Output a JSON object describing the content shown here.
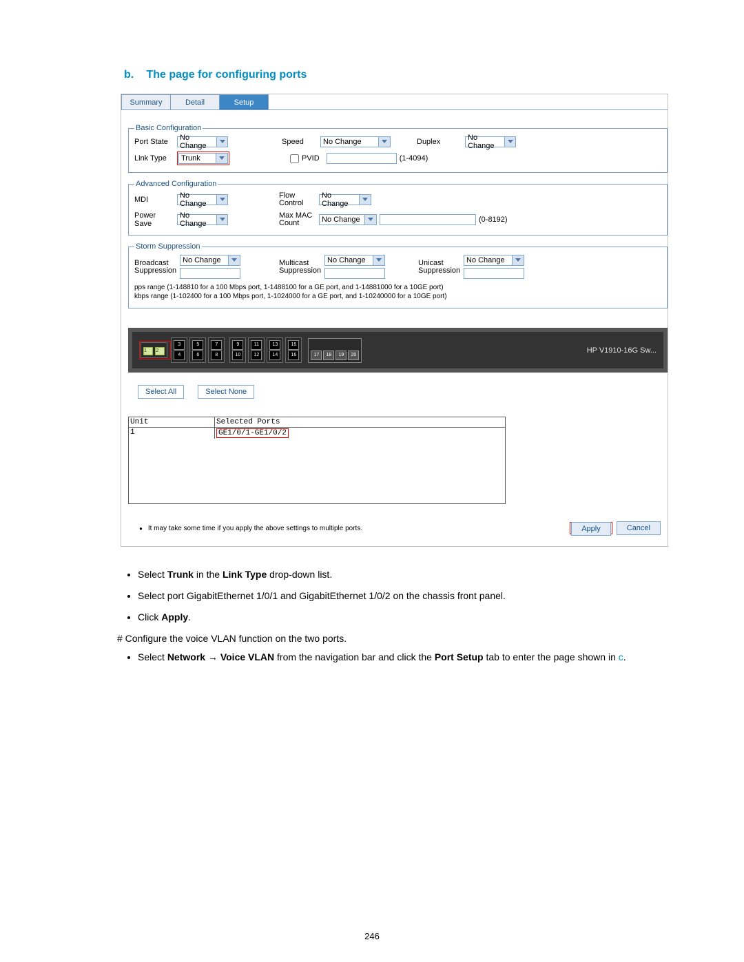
{
  "heading": {
    "letter": "b.",
    "text": "The page for configuring ports"
  },
  "tabs": {
    "summary": "Summary",
    "detail": "Detail",
    "setup": "Setup"
  },
  "basic": {
    "legend": "Basic Configuration",
    "port_state_label": "Port State",
    "port_state_value": "No Change",
    "speed_label": "Speed",
    "speed_value": "No Change",
    "duplex_label": "Duplex",
    "duplex_value": "No Change",
    "link_type_label": "Link Type",
    "link_type_value": "Trunk",
    "pvid_label": "PVID",
    "pvid_hint": "(1-4094)"
  },
  "advanced": {
    "legend": "Advanced Configuration",
    "mdi_label": "MDI",
    "mdi_value": "No Change",
    "flow_label": "Flow Control",
    "flow_value": "No Change",
    "power_label": "Power Save",
    "power_value": "No Change",
    "mac_label": "Max MAC Count",
    "mac_value": "No Change",
    "mac_hint": "(0-8192)"
  },
  "storm": {
    "legend": "Storm Suppression",
    "broadcast_label": "Broadcast Suppression",
    "broadcast_value": "No Change",
    "multicast_label": "Multicast Suppression",
    "multicast_value": "No Change",
    "unicast_label": "Unicast Suppression",
    "unicast_value": "No Change",
    "info1": "pps range (1-148810 for a 100 Mbps port, 1-1488100 for a GE port, and 1-14881000 for a 10GE port)",
    "info2": "kbps range (1-102400 for a 100 Mbps port, 1-1024000 for a GE port, and 1-10240000 for a 10GE port)"
  },
  "chassis": {
    "model": "HP V1910-16G Sw...",
    "ports_row1": [
      "1",
      "3",
      "5",
      "7",
      "9",
      "11",
      "13",
      "15"
    ],
    "ports_row2": [
      "2",
      "4",
      "6",
      "8",
      "10",
      "12",
      "14",
      "16"
    ],
    "extra_row": [
      "17",
      "18",
      "19",
      "20"
    ]
  },
  "buttons": {
    "select_all": "Select All",
    "select_none": "Select None",
    "apply": "Apply",
    "cancel": "Cancel"
  },
  "table": {
    "unit_hdr": "Unit",
    "sel_hdr": "Selected Ports",
    "unit_val": "1",
    "sel_val": "GE1/0/1-GE1/0/2"
  },
  "note": "It may take some time if you apply the above settings to multiple ports.",
  "instructions": {
    "i1a": "Select ",
    "i1b": "Trunk",
    "i1c": " in the ",
    "i1d": "Link Type",
    "i1e": " drop-down list.",
    "i2": "Select port GigabitEthernet 1/0/1 and GigabitEthernet 1/0/2 on the chassis front panel.",
    "i3a": "Click ",
    "i3b": "Apply",
    "i3c": ".",
    "p1": "# Configure the voice VLAN function on the two ports.",
    "i4a": "Select ",
    "i4b": "Network",
    "i4c": " → ",
    "i4d": "Voice VLAN",
    "i4e": " from the navigation bar and click the ",
    "i4f": "Port Setup",
    "i4g": " tab to enter the page shown in ",
    "i4h": "c",
    "i4i": "."
  },
  "page_number": "246"
}
